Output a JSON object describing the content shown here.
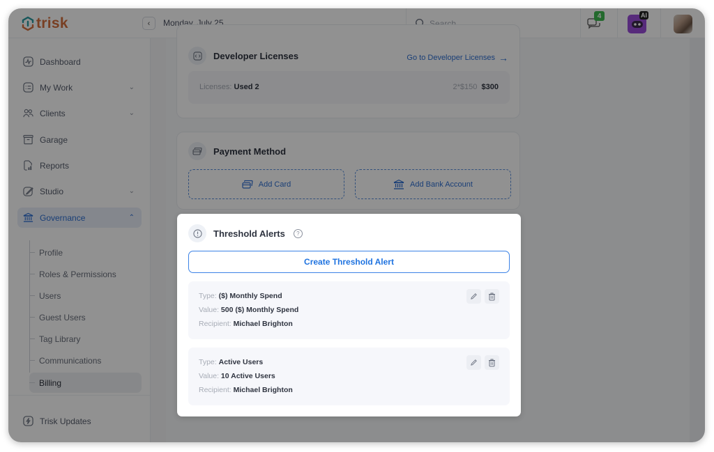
{
  "app": {
    "brand": "trisk",
    "brand_color": "#d4703e",
    "brand_accent": "#2a9aa0",
    "accent_color": "#2f6fd1"
  },
  "topbar": {
    "date": "Monday, July 25",
    "search_placeholder": "Search",
    "chat_badge_count": "4",
    "ai_badge": "AI"
  },
  "sidebar": {
    "items": [
      {
        "label": "Dashboard",
        "icon": "pulse-icon",
        "has_chevron": false
      },
      {
        "label": "My Work",
        "icon": "task-list-icon",
        "has_chevron": true
      },
      {
        "label": "Clients",
        "icon": "users-icon",
        "has_chevron": true
      },
      {
        "label": "Garage",
        "icon": "archive-box-icon",
        "has_chevron": false
      },
      {
        "label": "Reports",
        "icon": "report-chart-icon",
        "has_chevron": false
      },
      {
        "label": "Studio",
        "icon": "pen-icon",
        "has_chevron": true
      },
      {
        "label": "Governance",
        "icon": "bank-icon",
        "has_chevron": true,
        "active": true,
        "expanded": true
      }
    ],
    "sub_items": [
      {
        "label": "Profile"
      },
      {
        "label": "Roles & Permissions"
      },
      {
        "label": "Users"
      },
      {
        "label": "Guest Users"
      },
      {
        "label": "Tag Library"
      },
      {
        "label": "Communications"
      },
      {
        "label": "Billing",
        "active": true
      }
    ],
    "footer": {
      "label": "Trisk Updates",
      "icon": "lightning-icon"
    }
  },
  "main": {
    "developer_licenses": {
      "title": "Developer Licenses",
      "link": "Go to Developer Licenses",
      "licenses_label": "Licenses:",
      "licenses_value": "Used 2",
      "formula": "2*$150",
      "total": "$300"
    },
    "payment_method": {
      "title": "Payment Method",
      "add_card": "Add Card",
      "add_bank": "Add Bank Account"
    }
  },
  "modal": {
    "title": "Threshold Alerts",
    "create_button": "Create Threshold Alert",
    "alerts": [
      {
        "type_label": "Type:",
        "type": "($) Monthly Spend",
        "value_label": "Value:",
        "value": "500 ($) Monthly Spend",
        "recipient_label": "Recipient:",
        "recipient": "Michael Brighton"
      },
      {
        "type_label": "Type:",
        "type": "Active Users",
        "value_label": "Value:",
        "value": "10 Active Users",
        "recipient_label": "Recipient:",
        "recipient": "Michael Brighton"
      }
    ]
  }
}
